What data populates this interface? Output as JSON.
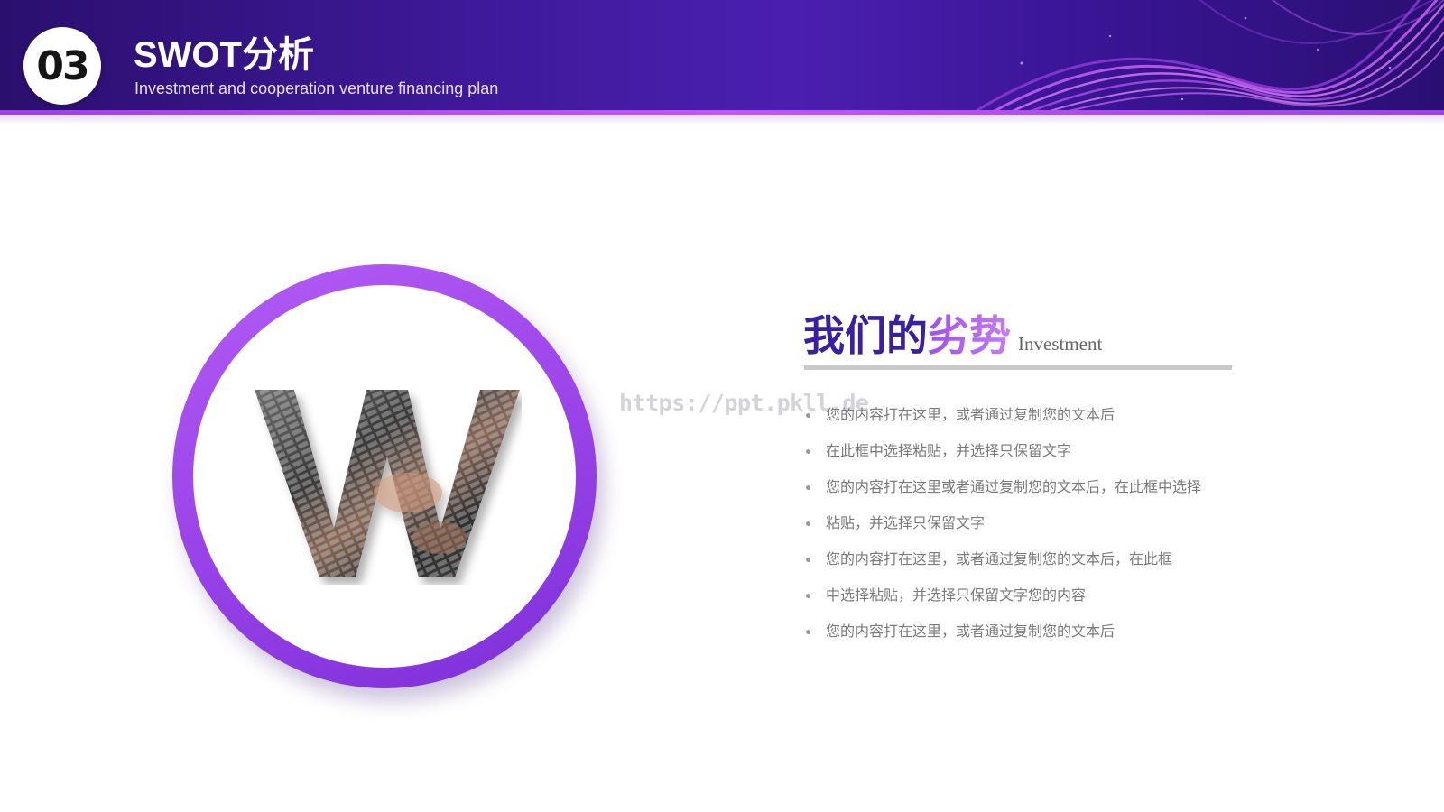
{
  "header": {
    "number": "03",
    "title": "SWOT分析",
    "subtitle": "Investment and cooperation venture financing plan"
  },
  "graphic": {
    "letter": "W"
  },
  "watermark": "https://ppt.pkll.de",
  "content": {
    "heading_part1": "我们的",
    "heading_part2": "劣势",
    "heading_tag": "Investment",
    "bullets": [
      "您的内容打在这里，或者通过复制您的文本后",
      "在此框中选择粘贴，并选择只保留文字",
      "您的内容打在这里或者通过复制您的文本后，在此框中选择",
      "粘贴，并选择只保留文字",
      "您的内容打在这里，或者通过复制您的文本后，在此框",
      "中选择粘贴，并选择只保留文字您的内容",
      "您的内容打在这里，或者通过复制您的文本后"
    ]
  },
  "colors": {
    "header_dark": "#2b0f6e",
    "header_mid": "#4a1fb0",
    "accent_purple": "#a24df0",
    "heading_navy": "#3a1fa0",
    "body_text": "#7a7a7a"
  }
}
